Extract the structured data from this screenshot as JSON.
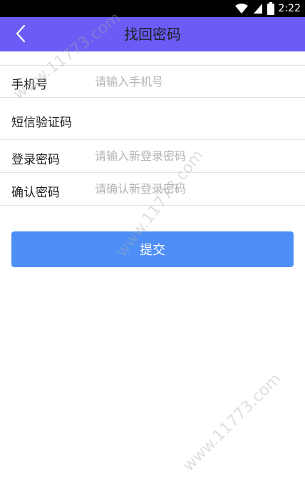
{
  "status_bar": {
    "time": "2:22",
    "icons": [
      "wifi-icon",
      "signal-icon",
      "battery-icon"
    ]
  },
  "header": {
    "title": "找回密码",
    "back_icon": "chevron-left-icon",
    "background_color": "#6a5cf5"
  },
  "form": {
    "phone": {
      "label": "手机号",
      "placeholder": "请输入手机号",
      "value": ""
    },
    "sms_code": {
      "label": "短信验证码",
      "value": ""
    },
    "new_password": {
      "label": "登录密码",
      "placeholder": "请输入新登录密码",
      "value": ""
    },
    "confirm_password": {
      "label": "确认密码",
      "placeholder": "请确认新登录密码",
      "value": ""
    }
  },
  "submit": {
    "label": "提交",
    "color": "#4d8ef7"
  },
  "watermark": {
    "text": "www.11773.com"
  }
}
